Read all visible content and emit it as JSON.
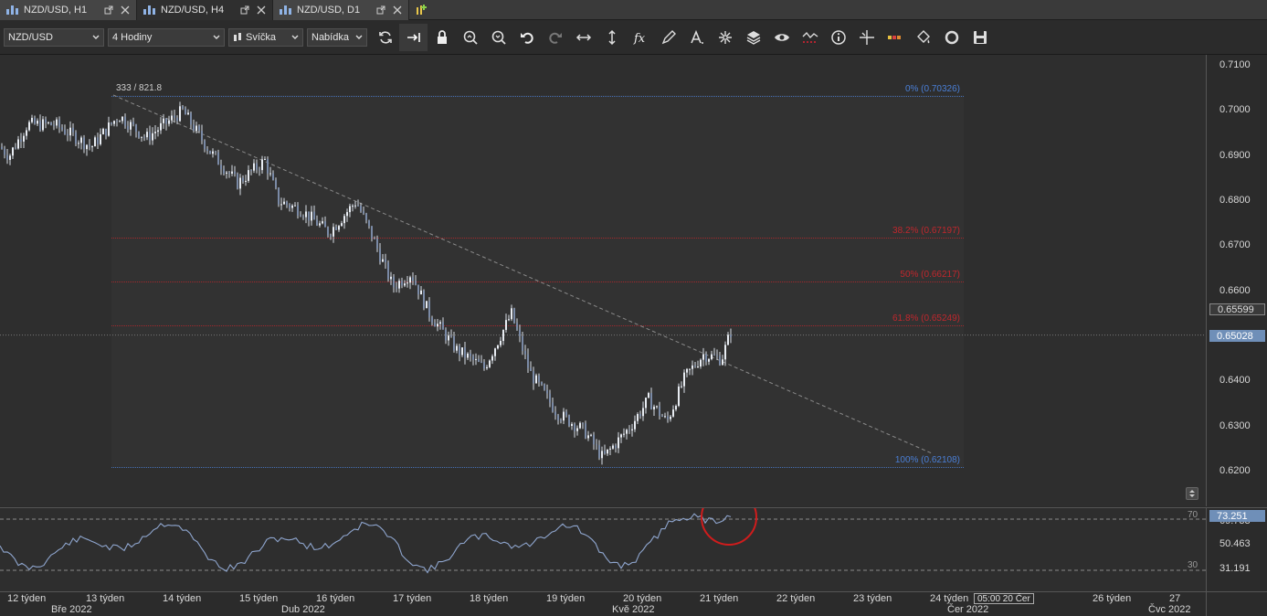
{
  "tabs": [
    {
      "label": "NZD/USD, H1",
      "active": false
    },
    {
      "label": "NZD/USD, H4",
      "active": true
    },
    {
      "label": "NZD/USD, D1",
      "active": false
    }
  ],
  "toolbar": {
    "instrument": "NZD/USD",
    "period": "4 Hodiny",
    "chart_type": "Svíčka",
    "price_side": "Nabídka"
  },
  "chart": {
    "measure_label": "333 / 821.8",
    "fib": [
      {
        "label": "0% (0.70326)",
        "value": 0.70326,
        "color": "#4a7fd6"
      },
      {
        "label": "38.2% (0.67197)",
        "value": 0.67197,
        "color": "#c0272d"
      },
      {
        "label": "50% (0.66217)",
        "value": 0.66217,
        "color": "#c0272d"
      },
      {
        "label": "61.8% (0.65249)",
        "value": 0.65249,
        "color": "#c0272d"
      },
      {
        "label": "100% (0.62108)",
        "value": 0.62108,
        "color": "#4a7fd6"
      }
    ],
    "yticks": [
      "0.7100",
      "0.7000",
      "0.6900",
      "0.6800",
      "0.6700",
      "0.6600",
      "0.6400",
      "0.6300",
      "0.6200"
    ],
    "price_tag_grey": "0.65599",
    "price_tag_current": "0.65028",
    "current_price": 0.65028
  },
  "indicator": {
    "level_high": "70",
    "level_low": "30",
    "ticks": [
      "50.463",
      "31.191"
    ],
    "value_tag": "73.251",
    "hidden_tick": "69.733",
    "highlight_color": "#d01c1c"
  },
  "timeaxis": {
    "weeks": [
      "12 týden",
      "13 týden",
      "14 týden",
      "15 týden",
      "16 týden",
      "17 týden",
      "18 týden",
      "19 týden",
      "20 týden",
      "21 týden",
      "22 týden",
      "23 týden",
      "24 týden",
      "26 týden",
      "27"
    ],
    "months": [
      "Bře 2022",
      "Dub 2022",
      "Kvě 2022",
      "Čer 2022",
      "Čvc 2022"
    ],
    "cursor_time": "05:00 20 Čer"
  },
  "chart_data": {
    "type": "candlestick",
    "ylim": [
      0.615,
      0.712
    ],
    "approx_close_path": [
      [
        0,
        0.692
      ],
      [
        10,
        0.69
      ],
      [
        30,
        0.697
      ],
      [
        60,
        0.697
      ],
      [
        100,
        0.692
      ],
      [
        130,
        0.699
      ],
      [
        160,
        0.694
      ],
      [
        200,
        0.7
      ],
      [
        230,
        0.691
      ],
      [
        260,
        0.684
      ],
      [
        290,
        0.689
      ],
      [
        305,
        0.68
      ],
      [
        330,
        0.678
      ],
      [
        360,
        0.673
      ],
      [
        390,
        0.68
      ],
      [
        410,
        0.671
      ],
      [
        430,
        0.661
      ],
      [
        450,
        0.664
      ],
      [
        470,
        0.655
      ],
      [
        500,
        0.647
      ],
      [
        530,
        0.643
      ],
      [
        560,
        0.655
      ],
      [
        580,
        0.642
      ],
      [
        610,
        0.633
      ],
      [
        640,
        0.629
      ],
      [
        660,
        0.623
      ],
      [
        690,
        0.63
      ],
      [
        710,
        0.636
      ],
      [
        730,
        0.631
      ],
      [
        750,
        0.641
      ],
      [
        770,
        0.646
      ],
      [
        790,
        0.645
      ],
      [
        800,
        0.651
      ]
    ]
  }
}
